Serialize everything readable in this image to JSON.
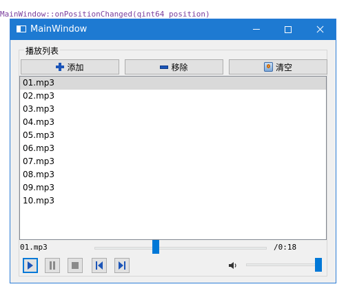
{
  "background_snippet": "MainWindow::onPositionChanged(qint64 position)",
  "window": {
    "title": "MainWindow",
    "titlebar_color": "#1e7ad2"
  },
  "playlist": {
    "group_title": "播放列表",
    "buttons": {
      "add_label": "添加",
      "remove_label": "移除",
      "clear_label": "清空"
    },
    "items": [
      "01.mp3",
      "02.mp3",
      "03.mp3",
      "04.mp3",
      "05.mp3",
      "06.mp3",
      "07.mp3",
      "08.mp3",
      "09.mp3",
      "10.mp3"
    ],
    "selected_index": 0
  },
  "player": {
    "current_file": "01.mp3",
    "time_text": "/0:18",
    "position_fraction": 0.35,
    "volume_fraction": 1.0,
    "accent_color": "#0078d7",
    "controls": [
      "play-icon",
      "pause-icon",
      "stop-icon",
      "previous-icon",
      "next-icon"
    ],
    "volume_icon": "speaker-icon"
  }
}
